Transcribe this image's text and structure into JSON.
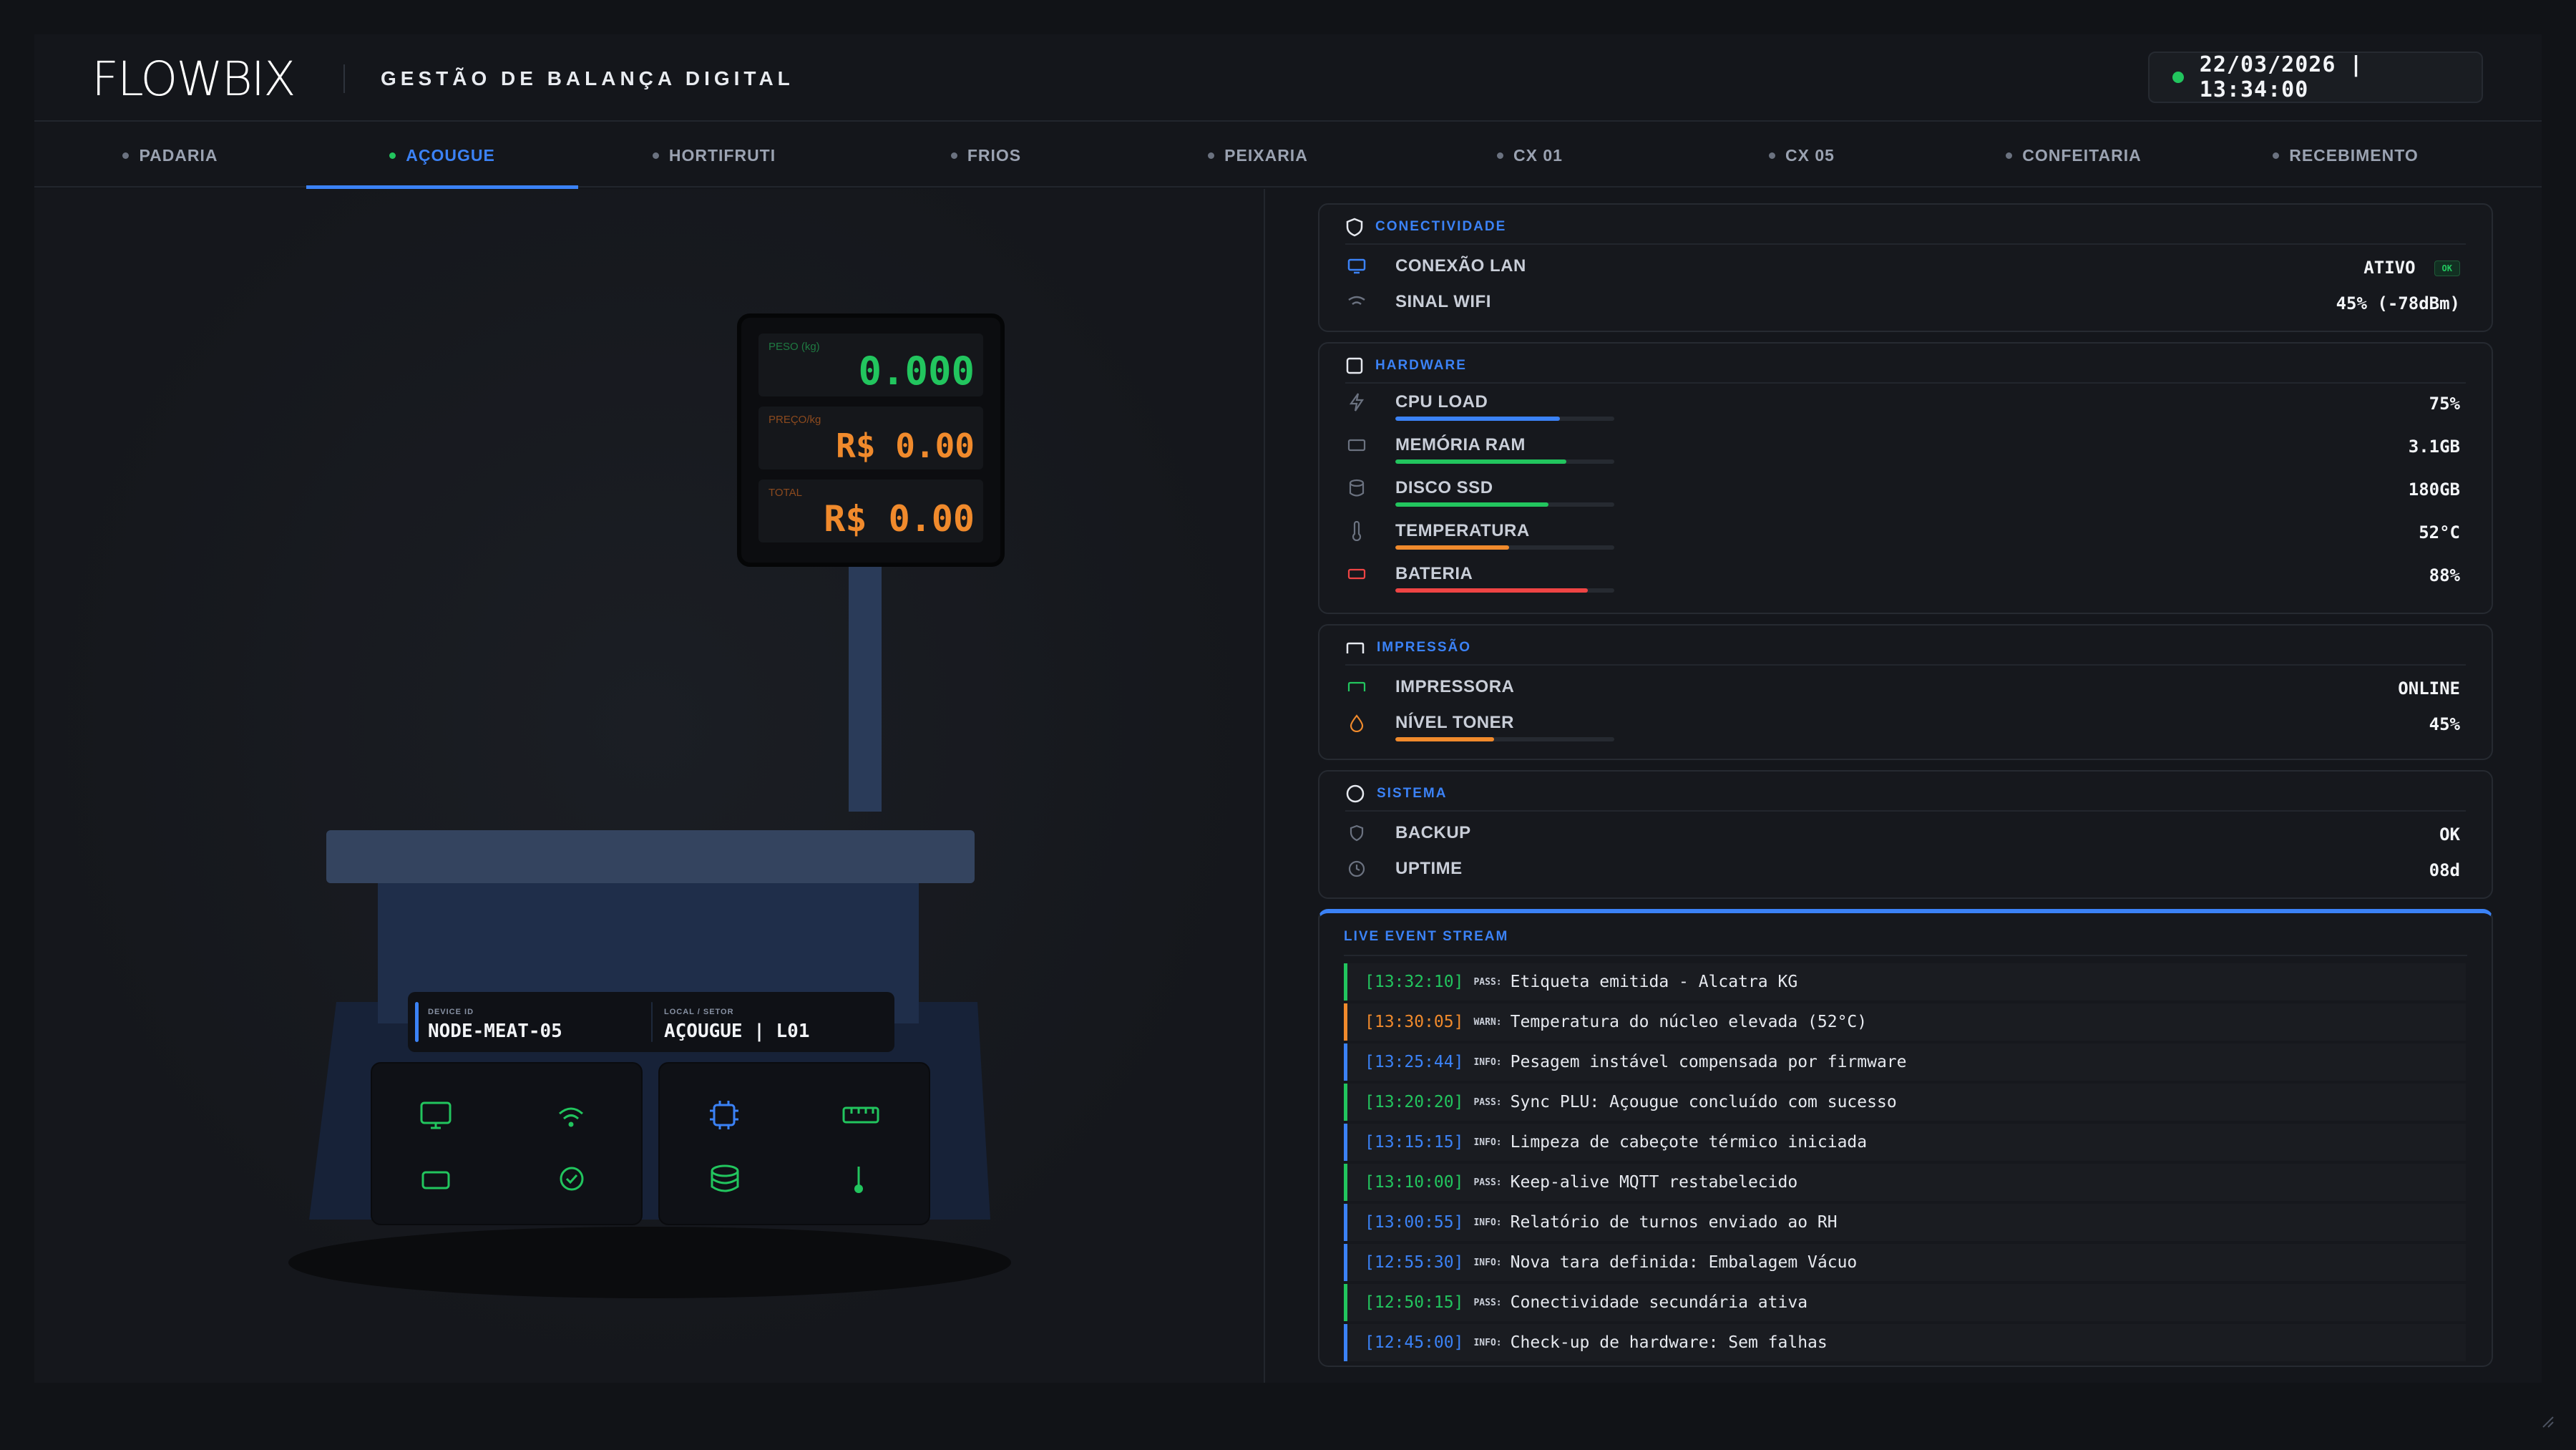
{
  "header": {
    "logo": "FLOWBIX",
    "title": "GESTÃO DE BALANÇA DIGITAL",
    "datetime": "22/03/2026 | 13:34:00"
  },
  "tabs": [
    {
      "label": "PADARIA",
      "active": false
    },
    {
      "label": "AÇOUGUE",
      "active": true
    },
    {
      "label": "HORTIFRUTI",
      "active": false
    },
    {
      "label": "FRIOS",
      "active": false
    },
    {
      "label": "PEIXARIA",
      "active": false
    },
    {
      "label": "CX 01",
      "active": false
    },
    {
      "label": "CX 05",
      "active": false
    },
    {
      "label": "CONFEITARIA",
      "active": false
    },
    {
      "label": "RECEBIMENTO",
      "active": false
    }
  ],
  "scale": {
    "weight_label": "PESO (kg)",
    "weight_value": "0.000",
    "price_label": "PREÇO/kg",
    "price_value": "R$ 0.00",
    "total_label": "TOTAL",
    "total_value": "R$ 0.00",
    "device_id_label": "DEVICE ID",
    "device_id": "NODE-MEAT-05",
    "location_label": "LOCAL / SETOR",
    "location": "AÇOUGUE | L01"
  },
  "connectivity": {
    "title": "CONECTIVIDADE",
    "lan_label": "CONEXÃO LAN",
    "lan_value": "ATIVO",
    "lan_badge": "OK",
    "wifi_label": "SINAL WIFI",
    "wifi_value": "45% (-78dBm)"
  },
  "hardware": {
    "title": "HARDWARE",
    "items": [
      {
        "label": "CPU LOAD",
        "value": "75%",
        "level": 0.75,
        "color": "#3b82f6",
        "icon": "bolt-icon"
      },
      {
        "label": "MEMÓRIA RAM",
        "value": "3.1GB",
        "level": 0.78,
        "color": "#22c55e",
        "icon": "memory-icon"
      },
      {
        "label": "DISCO SSD",
        "value": "180GB",
        "level": 0.7,
        "color": "#22c55e",
        "icon": "disk-icon"
      },
      {
        "label": "TEMPERATURA",
        "value": "52°C",
        "level": 0.52,
        "color": "#f08a2c",
        "icon": "thermometer-icon"
      },
      {
        "label": "BATERIA",
        "value": "88%",
        "level": 0.88,
        "color": "#ef4444",
        "icon": "battery-icon"
      }
    ]
  },
  "printing": {
    "title": "IMPRESSÃO",
    "printer_label": "IMPRESSORA",
    "printer_value": "ONLINE",
    "toner_label": "NÍVEL TONER",
    "toner_value": "45%",
    "toner_level": 0.45
  },
  "system": {
    "title": "SISTEMA",
    "backup_label": "BACKUP",
    "backup_value": "OK",
    "uptime_label": "UPTIME",
    "uptime_value": "08d"
  },
  "stream": {
    "title": "LIVE EVENT STREAM",
    "events": [
      {
        "time": "[13:32:10]",
        "level": "PASS:",
        "type": "pass",
        "message": "Etiqueta emitida - Alcatra KG"
      },
      {
        "time": "[13:30:05]",
        "level": "WARN:",
        "type": "warn",
        "message": "Temperatura do núcleo elevada (52°C)"
      },
      {
        "time": "[13:25:44]",
        "level": "INFO:",
        "type": "info",
        "message": "Pesagem instável compensada por firmware"
      },
      {
        "time": "[13:20:20]",
        "level": "PASS:",
        "type": "pass",
        "message": "Sync PLU: Açougue concluído com sucesso"
      },
      {
        "time": "[13:15:15]",
        "level": "INFO:",
        "type": "info",
        "message": "Limpeza de cabeçote térmico iniciada"
      },
      {
        "time": "[13:10:00]",
        "level": "PASS:",
        "type": "pass",
        "message": "Keep-alive MQTT restabelecido"
      },
      {
        "time": "[13:00:55]",
        "level": "INFO:",
        "type": "info",
        "message": "Relatório de turnos enviado ao RH"
      },
      {
        "time": "[12:55:30]",
        "level": "INFO:",
        "type": "info",
        "message": "Nova tara definida: Embalagem Vácuo"
      },
      {
        "time": "[12:50:15]",
        "level": "PASS:",
        "type": "pass",
        "message": "Conectividade secundária ativa"
      },
      {
        "time": "[12:45:00]",
        "level": "INFO:",
        "type": "info",
        "message": "Check-up de hardware: Sem falhas"
      }
    ]
  },
  "colors": {
    "accent": "#3b82f6",
    "ok": "#22c55e",
    "warn": "#f08a2c",
    "danger": "#ef4444"
  }
}
